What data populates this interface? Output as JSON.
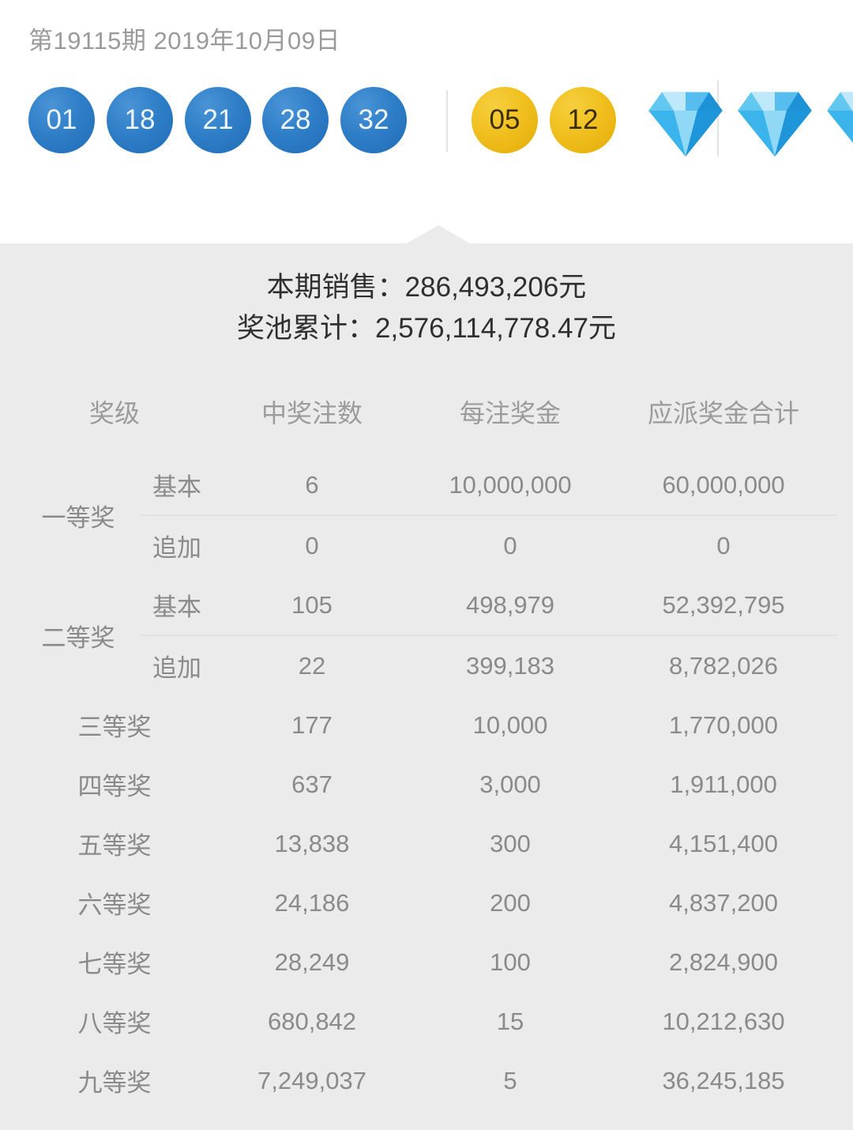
{
  "header": {
    "issue_line": "第19115期 2019年10月09日",
    "front_balls": [
      "01",
      "18",
      "21",
      "28",
      "32"
    ],
    "back_balls": [
      "05",
      "12"
    ],
    "diamonds": [
      "diamond-icon",
      "diamond-icon",
      "diamond-icon"
    ],
    "colors": {
      "front_ball": "#2f7fc8",
      "back_ball": "#f0c01f",
      "diamond": "#29a3e8"
    }
  },
  "summary": {
    "sales_label": "本期销售：",
    "sales_value": "286,493,206元",
    "pool_label": "奖池累计：",
    "pool_value": "2,576,114,778.47元",
    "sales_line": "本期销售：286,493,206元",
    "pool_line": "奖池累计：2,576,114,778.47元"
  },
  "table": {
    "headers": [
      "奖级",
      "中奖注数",
      "每注奖金",
      "应派奖金合计"
    ],
    "sub_labels": {
      "basic": "基本",
      "extra": "追加"
    },
    "amount_color": "#cc2a22",
    "rows": [
      {
        "grade": "一等奖",
        "split": true,
        "sub": [
          {
            "label": "基本",
            "count": "6",
            "per": "10,000,000",
            "total": "60,000,000"
          },
          {
            "label": "追加",
            "count": "0",
            "per": "0",
            "total": "0"
          }
        ]
      },
      {
        "grade": "二等奖",
        "split": true,
        "sub": [
          {
            "label": "基本",
            "count": "105",
            "per": "498,979",
            "total": "52,392,795"
          },
          {
            "label": "追加",
            "count": "22",
            "per": "399,183",
            "total": "8,782,026"
          }
        ]
      },
      {
        "grade": "三等奖",
        "split": false,
        "count": "177",
        "per": "10,000",
        "total": "1,770,000"
      },
      {
        "grade": "四等奖",
        "split": false,
        "count": "637",
        "per": "3,000",
        "total": "1,911,000"
      },
      {
        "grade": "五等奖",
        "split": false,
        "count": "13,838",
        "per": "300",
        "total": "4,151,400"
      },
      {
        "grade": "六等奖",
        "split": false,
        "count": "24,186",
        "per": "200",
        "total": "4,837,200"
      },
      {
        "grade": "七等奖",
        "split": false,
        "count": "28,249",
        "per": "100",
        "total": "2,824,900"
      },
      {
        "grade": "八等奖",
        "split": false,
        "count": "680,842",
        "per": "15",
        "total": "10,212,630"
      },
      {
        "grade": "九等奖",
        "split": false,
        "count": "7,249,037",
        "per": "5",
        "total": "36,245,185"
      }
    ]
  }
}
